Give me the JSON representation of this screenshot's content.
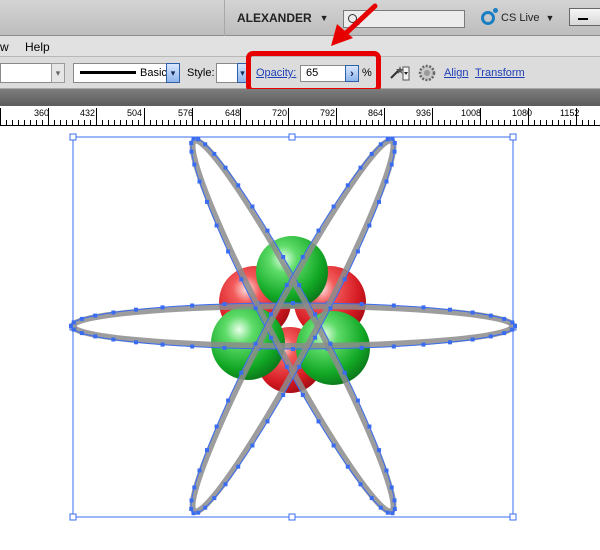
{
  "titlebar": {
    "workspace": "ALEXANDER",
    "cs_live": "CS Live"
  },
  "menu": {
    "items": [
      "w",
      "Help"
    ]
  },
  "controls": {
    "stroke_profile": "Basic",
    "style_label": "Style:",
    "opacity_label": "Opacity:",
    "opacity_value": "65",
    "percent": "%",
    "align": "Align",
    "transform": "Transform"
  },
  "ruler": {
    "labels": [
      "360",
      "432",
      "504",
      "576",
      "648",
      "720",
      "792",
      "864",
      "936",
      "1008",
      "1080",
      "1152"
    ]
  },
  "colors": {
    "selection": "#3a6cf2",
    "highlight": "#e60000",
    "proton": "#e0222a",
    "neutron": "#18b42a",
    "orbit": "#8c8c8c"
  }
}
